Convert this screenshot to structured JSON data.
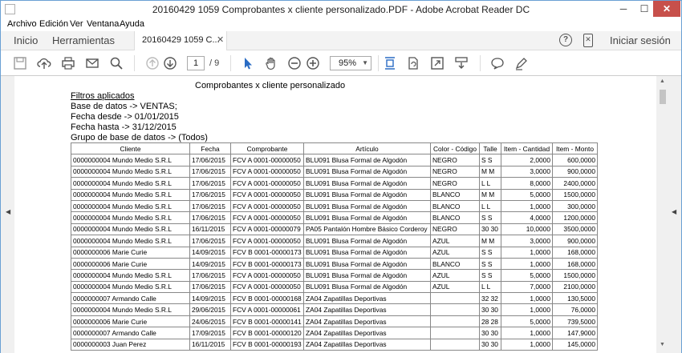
{
  "window": {
    "title": "20160429 1059 Comprobantes x cliente personalizado.PDF - Adobe Acrobat Reader DC",
    "minimize": "─",
    "maximize": "☐",
    "close": "✕"
  },
  "menu": [
    "Archivo",
    "Edición",
    "Ver",
    "Ventana",
    "Ayuda"
  ],
  "tabs": {
    "home": "Inicio",
    "tools": "Herramientas",
    "document": "20160429 1059 C...",
    "close": "✕",
    "help": "?",
    "sign_in": "Iniciar sesión"
  },
  "toolbar": {
    "page_current": "1",
    "page_total": "/ 9",
    "zoom": "95%",
    "zoom_caret": "▼"
  },
  "icons": [
    "save-icon",
    "cloud-upload-icon",
    "print-icon",
    "email-icon",
    "search-icon",
    "previous-page-icon",
    "next-page-icon",
    "cursor-icon",
    "hand-icon",
    "zoom-out-icon",
    "zoom-in-icon",
    "fit-page-icon",
    "rotate-icon",
    "fullscreen-icon",
    "scroll-mode-icon",
    "comment-icon",
    "pen-icon"
  ],
  "document": {
    "title": "Comprobantes x cliente personalizado",
    "filters_title": "Filtros aplicados",
    "filters": [
      "Base de datos -> VENTAS;",
      "Fecha desde -> 01/01/2015",
      "Fecha hasta -> 31/12/2015",
      "Grupo de base de datos -> (Todos)"
    ],
    "table": {
      "columns": [
        "Cliente",
        "Fecha",
        "Comprobante",
        "Artículo",
        "Color - Código",
        "Talle",
        "Item - Cantidad",
        "Item - Monto"
      ],
      "rows": [
        [
          "0000000004 Mundo Medio S.R.L",
          "17/06/2015",
          "FCV A 0001-00000050",
          "BLU091 Blusa Formal de Algodón",
          "NEGRO",
          "S S",
          "2,0000",
          "600,0000"
        ],
        [
          "0000000004 Mundo Medio S.R.L",
          "17/06/2015",
          "FCV A 0001-00000050",
          "BLU091 Blusa Formal de Algodón",
          "NEGRO",
          "M M",
          "3,0000",
          "900,0000"
        ],
        [
          "0000000004 Mundo Medio S.R.L",
          "17/06/2015",
          "FCV A 0001-00000050",
          "BLU091 Blusa Formal de Algodón",
          "NEGRO",
          "L L",
          "8,0000",
          "2400,0000"
        ],
        [
          "0000000004 Mundo Medio S.R.L",
          "17/06/2015",
          "FCV A 0001-00000050",
          "BLU091 Blusa Formal de Algodón",
          "BLANCO",
          "M M",
          "5,0000",
          "1500,0000"
        ],
        [
          "0000000004 Mundo Medio S.R.L",
          "17/06/2015",
          "FCV A 0001-00000050",
          "BLU091 Blusa Formal de Algodón",
          "BLANCO",
          "L L",
          "1,0000",
          "300,0000"
        ],
        [
          "0000000004 Mundo Medio S.R.L",
          "17/06/2015",
          "FCV A 0001-00000050",
          "BLU091 Blusa Formal de Algodón",
          "BLANCO",
          "S S",
          "4,0000",
          "1200,0000"
        ],
        [
          "0000000004 Mundo Medio S.R.L",
          "16/11/2015",
          "FCV A 0001-00000079",
          "PA05 Pantalón Hombre Básico Corderoy",
          "NEGRO",
          "30 30",
          "10,0000",
          "3500,0000"
        ],
        [
          "0000000004 Mundo Medio S.R.L",
          "17/06/2015",
          "FCV A 0001-00000050",
          "BLU091 Blusa Formal de Algodón",
          "AZUL",
          "M M",
          "3,0000",
          "900,0000"
        ],
        [
          "0000000006 Marie Curie",
          "14/09/2015",
          "FCV B 0001-00000173",
          "BLU091 Blusa Formal de Algodón",
          "AZUL",
          "S S",
          "1,0000",
          "168,0000"
        ],
        [
          "0000000006 Marie Curie",
          "14/09/2015",
          "FCV B 0001-00000173",
          "BLU091 Blusa Formal de Algodón",
          "BLANCO",
          "S S",
          "1,0000",
          "168,0000"
        ],
        [
          "0000000004 Mundo Medio S.R.L",
          "17/06/2015",
          "FCV A 0001-00000050",
          "BLU091 Blusa Formal de Algodón",
          "AZUL",
          "S S",
          "5,0000",
          "1500,0000"
        ],
        [
          "0000000004 Mundo Medio S.R.L",
          "17/06/2015",
          "FCV A 0001-00000050",
          "BLU091 Blusa Formal de Algodón",
          "AZUL",
          "L L",
          "7,0000",
          "2100,0000"
        ],
        [
          "0000000007 Armando Calle",
          "14/09/2015",
          "FCV B 0001-00000168",
          "ZA04 Zapatillas Deportivas",
          "",
          "32 32",
          "1,0000",
          "130,5000"
        ],
        [
          "0000000004 Mundo Medio S.R.L",
          "29/06/2015",
          "FCV A 0001-00000061",
          "ZA04 Zapatillas Deportivas",
          "",
          "30 30",
          "1,0000",
          "76,0000"
        ],
        [
          "0000000006 Marie Curie",
          "24/06/2015",
          "FCV B 0001-00000141",
          "ZA04 Zapatillas Deportivas",
          "",
          "28 28",
          "5,0000",
          "739,5000"
        ],
        [
          "0000000007 Armando Calle",
          "17/09/2015",
          "FCV B 0001-00000120",
          "ZA04 Zapatillas Deportivas",
          "",
          "30 30",
          "1,0000",
          "147,9000"
        ],
        [
          "0000000003 Juan Perez",
          "16/11/2015",
          "FCV B 0001-00000193",
          "ZA04 Zapatillas Deportivas",
          "",
          "30 30",
          "1,0000",
          "145,0000"
        ]
      ]
    }
  }
}
